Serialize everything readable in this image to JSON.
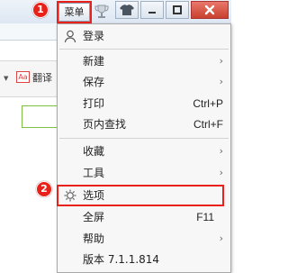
{
  "titlebar": {
    "menu_button_label": "菜单"
  },
  "background": {
    "translate_icon_text": "Aa",
    "translate_label": "翻译"
  },
  "annotations": {
    "step1": "1",
    "step2": "2",
    "highlight_color": "#e8221a"
  },
  "menu": {
    "login": "登录",
    "new": "新建",
    "save": "保存",
    "print": "打印",
    "print_shortcut": "Ctrl+P",
    "find": "页内查找",
    "find_shortcut": "Ctrl+F",
    "favorites": "收藏",
    "tools": "工具",
    "options": "选项",
    "fullscreen": "全屏",
    "fullscreen_shortcut": "F11",
    "help": "帮助",
    "version": "版本 7.1.1.814",
    "submenu_arrow": "›"
  },
  "icons": {
    "login": "user-icon",
    "options": "gear-icon",
    "trophy": "trophy-icon",
    "skin": "shirt-icon",
    "minimize": "minimize-icon",
    "maximize": "maximize-icon",
    "close": "close-icon"
  }
}
